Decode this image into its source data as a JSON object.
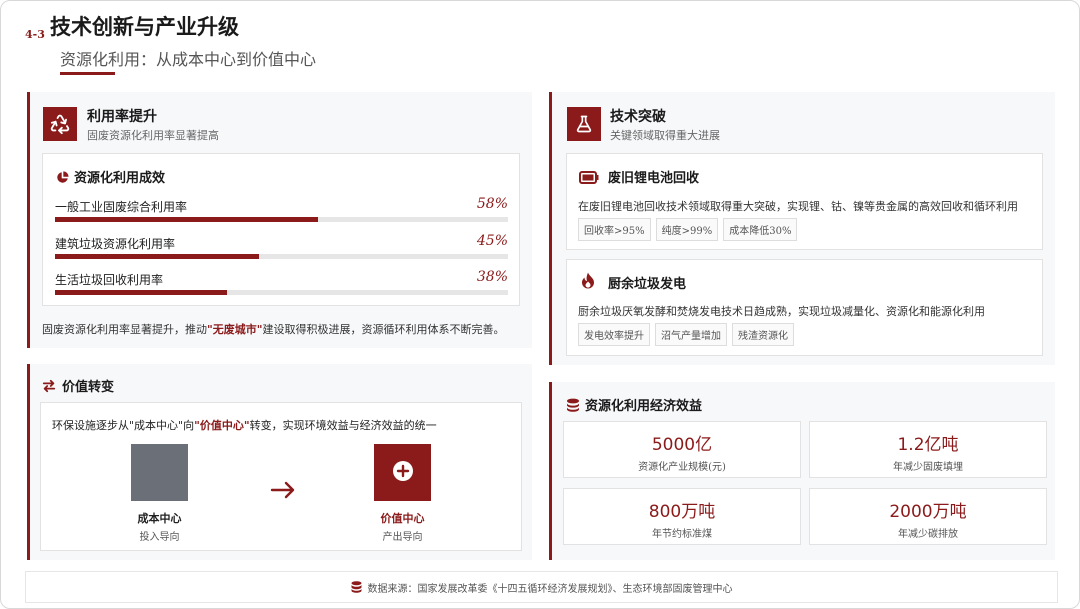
{
  "header": {
    "section_no": "4-3",
    "title": "技术创新与产业升级",
    "subtitle": "资源化利用：从成本中心到价值中心"
  },
  "utilization": {
    "title": "利用率提升",
    "subtitle": "固废资源化利用率显著提高",
    "card_title": "资源化利用成效",
    "rows": [
      {
        "label": "一般工业固废综合利用率",
        "value": "58%",
        "pct": 58
      },
      {
        "label": "建筑垃圾资源化利用率",
        "value": "45%",
        "pct": 45
      },
      {
        "label": "生活垃圾回收利用率",
        "value": "38%",
        "pct": 38
      }
    ],
    "note_pre": "固废资源化利用率显著提升，推动",
    "note_hl": "\"无废城市\"",
    "note_post": "建设取得积极进展，资源循环利用体系不断完善。"
  },
  "value_shift": {
    "title": "价值转变",
    "desc_pre": "环保设施逐步从\"成本中心\"向",
    "desc_hl": "\"价值中心\"",
    "desc_post": "转变，实现环境效益与经济效益的统一",
    "from_title": "成本中心",
    "from_sub": "投入导向",
    "to_title": "价值中心",
    "to_sub": "产出导向",
    "colors": {
      "from": "#6b6f78",
      "to": "#8b1a1a"
    }
  },
  "tech": {
    "title": "技术突破",
    "subtitle": "关键领域取得重大进展",
    "items": [
      {
        "title": "废旧锂电池回收",
        "desc": "在废旧锂电池回收技术领域取得重大突破，实现锂、钴、镍等贵金属的高效回收和循环利用",
        "tags": [
          "回收率>95%",
          "纯度>99%",
          "成本降低30%"
        ]
      },
      {
        "title": "厨余垃圾发电",
        "desc": "厨余垃圾厌氧发酵和焚烧发电技术日趋成熟，实现垃圾减量化、资源化和能源化利用",
        "tags": [
          "发电效率提升",
          "沼气产量增加",
          "残渣资源化"
        ]
      }
    ]
  },
  "economics": {
    "title": "资源化利用经济效益",
    "stats": [
      {
        "value": "5000亿",
        "label": "资源化产业规模(元)"
      },
      {
        "value": "1.2亿吨",
        "label": "年减少固废填埋"
      },
      {
        "value": "800万吨",
        "label": "年节约标准煤"
      },
      {
        "value": "2000万吨",
        "label": "年减少碳排放"
      }
    ]
  },
  "footer": {
    "source": "数据来源：国家发展改革委《十四五循环经济发展规划》、生态环境部固废管理中心"
  },
  "accent": "#8b1a1a"
}
